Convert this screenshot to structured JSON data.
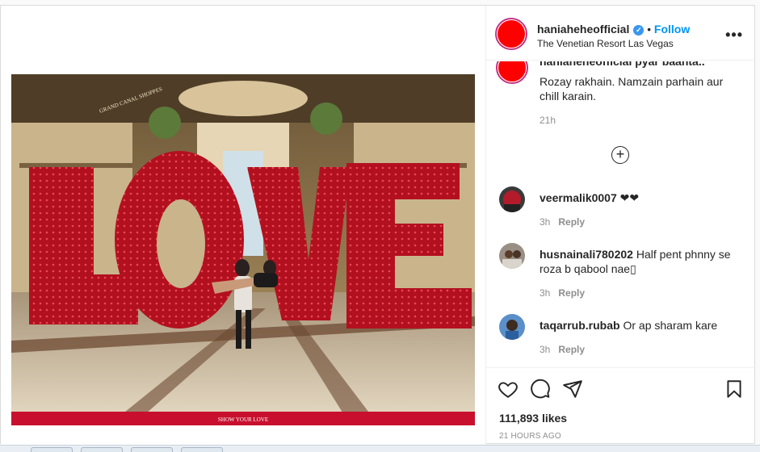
{
  "post": {
    "username": "haniaheheofficial",
    "follow_label": "Follow",
    "separator": "•",
    "location": "The Venetian Resort Las Vegas",
    "more_label": "•••"
  },
  "caption": {
    "clipped_line": "haniaheheofficial  pyar baanta..",
    "text": "Rozay rakhain. Namzain parhain aur chill karain.",
    "time": "21h",
    "load_more_symbol": "+"
  },
  "comments": [
    {
      "username": "veermalik0007",
      "text": "❤❤",
      "time": "3h",
      "reply": "Reply"
    },
    {
      "username": "husnainali780202",
      "text": "Half pent phnny se roza b qabool nae",
      "trailing_glyph": "▯",
      "time": "3h",
      "reply": "Reply"
    },
    {
      "username": "taqarrub.rubab",
      "text": "Or ap sharam kare",
      "time": "3h",
      "reply": "Reply"
    }
  ],
  "stats": {
    "likes": "111,893 likes",
    "posted": "21 HOURS AGO"
  },
  "photo_signs": {
    "letters": [
      "L",
      "O",
      "V",
      "E"
    ],
    "banner": "SHOW YOUR LOVE",
    "wall": "GRAND CANAL SHOPPES"
  },
  "colors": {
    "accent": "#0095f6",
    "avatar": "#ff0000",
    "sign_red": "#c8102e"
  },
  "icons": [
    "heart-icon",
    "comment-icon",
    "share-icon",
    "bookmark-icon",
    "verified-icon",
    "more-icon",
    "plus-circle-icon"
  ]
}
